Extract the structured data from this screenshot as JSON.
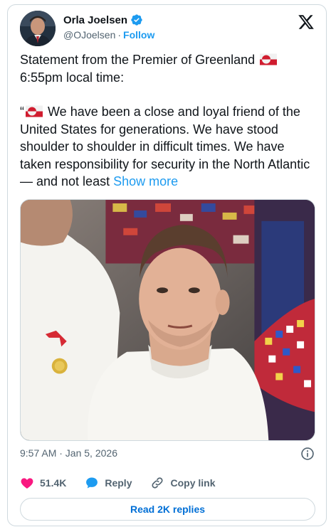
{
  "author": {
    "name": "Orla Joelsen",
    "handle": "@OJoelsen",
    "separator": "·",
    "follow_label": "Follow"
  },
  "tweet": {
    "line1_text": "Statement from the Premier of Greenland",
    "line2_text": "6:55pm local time:",
    "quote_open": "“",
    "quote_text": "We have been a close and loyal friend of the United States for generations. We have stood shoulder to shoulder in difficult times. We have taken responsibility for security in the North Atlantic — and not least",
    "show_more_label": "Show more"
  },
  "meta": {
    "timestamp": "9:57 AM · Jan 5, 2026"
  },
  "actions": {
    "like_count": "51.4K",
    "reply_label": "Reply",
    "copy_link_label": "Copy link",
    "read_replies_label": "Read 2K replies"
  },
  "icons": {
    "verified": "verified-badge-icon",
    "brand": "x-logo-icon",
    "info": "info-icon",
    "like": "heart-icon",
    "reply": "speech-bubble-icon",
    "copy": "link-icon",
    "flag": "greenland-flag-icon"
  },
  "colors": {
    "accent": "#1d9bf0",
    "like": "#f91880",
    "text": "#0f1419",
    "muted": "#536471",
    "border": "#cfd9de"
  }
}
